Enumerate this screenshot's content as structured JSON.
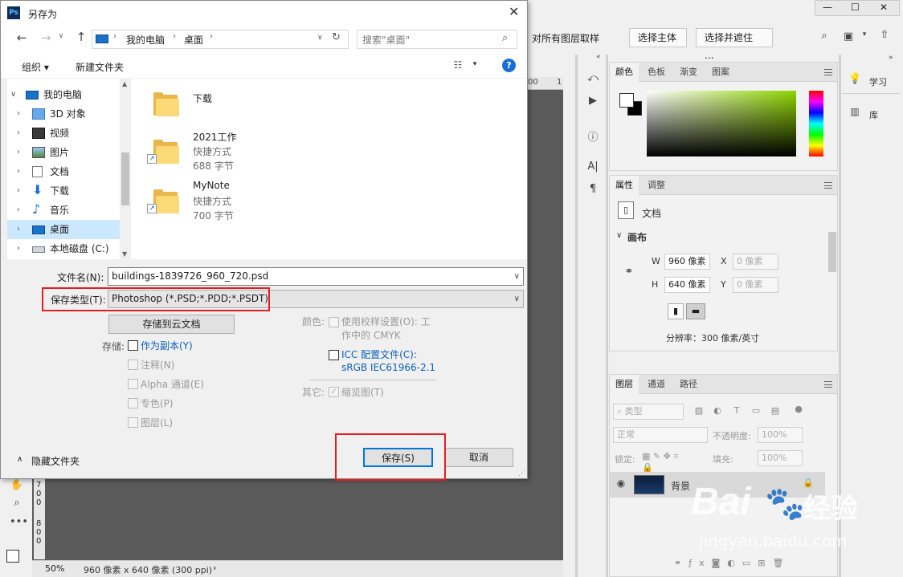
{
  "photoshop": {
    "window_controls": [
      "—",
      "☐",
      "✕"
    ],
    "options_bar": {
      "sample_all_layers": "对所有图层取样",
      "select_subject": "选择主体",
      "select_and_mask": "选择并遮住 ..."
    },
    "ruler_marks": [
      "00",
      "1"
    ],
    "color_panel": {
      "tabs": [
        "颜色",
        "色板",
        "渐变",
        "图案"
      ]
    },
    "right_strip": {
      "learn": "学习",
      "library": "库"
    },
    "properties_panel": {
      "tabs": [
        "属性",
        "调整"
      ],
      "doc_label": "文档",
      "section": "画布",
      "w_label": "W",
      "w_value": "960 像素",
      "h_label": "H",
      "h_value": "640 像素",
      "x_label": "X",
      "x_value": "0 像素",
      "y_label": "Y",
      "y_value": "0 像素",
      "resolution": "分辨率：300 像素/英寸"
    },
    "layers_panel": {
      "tabs": [
        "图层",
        "通道",
        "路径"
      ],
      "filter_kind": "类型",
      "blend_mode": "正常",
      "opacity_label": "不透明度:",
      "opacity_value": "100%",
      "lock_label": "锁定:",
      "fill_label": "填充:",
      "fill_value": "100%",
      "layer_name": "背景"
    },
    "status_bar": {
      "zoom": "50%",
      "doc_info": "960 像素 x 640 像素 (300 ppi)"
    },
    "ruler_left_digits": [
      "7",
      "0",
      "0",
      "8",
      "0",
      "0"
    ]
  },
  "dialog": {
    "title": "另存为",
    "address": {
      "segments": [
        "我的电脑",
        "桌面"
      ],
      "search_placeholder": "搜索\"桌面\""
    },
    "toolbar": {
      "organize": "组织 ▾",
      "new_folder": "新建文件夹"
    },
    "tree": [
      {
        "label": "我的电脑",
        "level": 0,
        "expanded": true
      },
      {
        "label": "3D 对象",
        "level": 1
      },
      {
        "label": "视频",
        "level": 1
      },
      {
        "label": "图片",
        "level": 1
      },
      {
        "label": "文档",
        "level": 1
      },
      {
        "label": "下载",
        "level": 1
      },
      {
        "label": "音乐",
        "level": 1
      },
      {
        "label": "桌面",
        "level": 1,
        "selected": true
      },
      {
        "label": "本地磁盘 (C:)",
        "level": 1
      }
    ],
    "files": [
      {
        "name": "下载",
        "type": "",
        "size": ""
      },
      {
        "name": "2021工作",
        "type": "快捷方式",
        "size": "688 字节"
      },
      {
        "name": "MyNote",
        "type": "快捷方式",
        "size": "700 字节"
      }
    ],
    "filename_label": "文件名(N):",
    "filename_value": "buildings-1839726_960_720.psd",
    "filetype_label": "保存类型(T):",
    "filetype_value": "Photoshop (*.PSD;*.PDD;*.PSDT)",
    "cloud_button": "存储到云文档",
    "save_options": {
      "label": "存储:",
      "as_copy": "作为副本(Y)",
      "notes": "注释(N)",
      "alpha": "Alpha 通道(E)",
      "spot": "专色(P)",
      "layers": "图层(L)"
    },
    "color_options": {
      "label": "颜色:",
      "proof_line1": "使用校样设置(O): 工",
      "proof_line2": "作中的 CMYK",
      "icc_line1": "ICC 配置文件(C):",
      "icc_line2": "sRGB IEC61966-2.1"
    },
    "other_options": {
      "label": "其它:",
      "thumbnail": "缩览图(T)"
    },
    "hide_folders": "隐藏文件夹",
    "save_button": "保存(S)",
    "cancel_button": "取消"
  },
  "watermark": {
    "brand": "Bai",
    "brand_cn": "经验",
    "url": "jingyan.baidu.com"
  },
  "colors": {
    "highlight_red": "#e02020",
    "selection_blue": "#cce8ff",
    "link_blue": "#0c5fb8",
    "canvas_gray": "#5a5a5a"
  }
}
